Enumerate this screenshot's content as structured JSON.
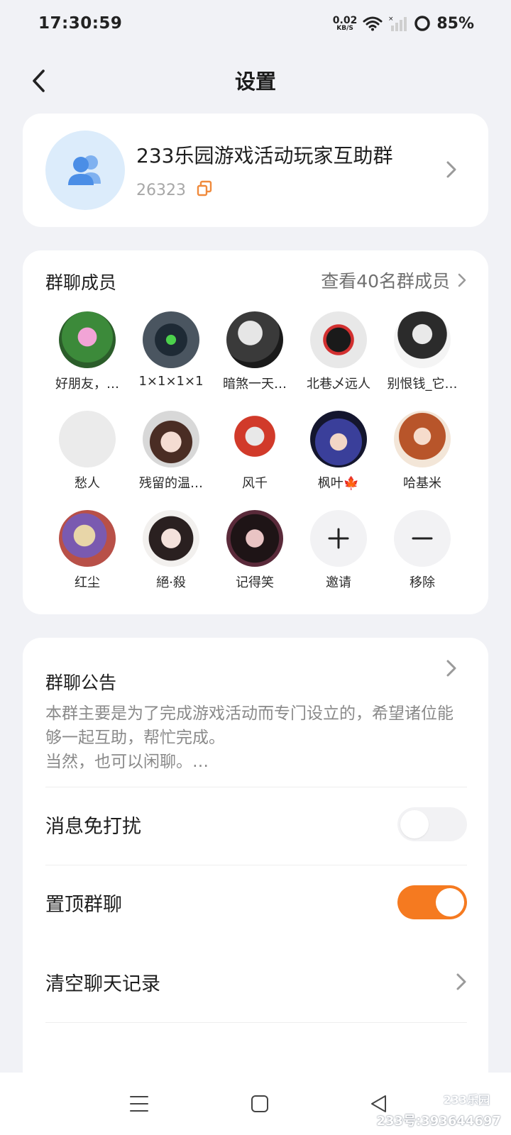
{
  "status_bar": {
    "time": "17:30:59",
    "net_speed_value": "0.02",
    "net_speed_unit": "KB/S",
    "battery": "85%"
  },
  "header": {
    "title": "设置"
  },
  "group": {
    "name": "233乐园游戏活动玩家互助群",
    "id": "26323"
  },
  "members": {
    "title": "群聊成员",
    "view_all": "查看40名群成员",
    "list": [
      {
        "name": "好朋友，…"
      },
      {
        "name": "1×1×1×1"
      },
      {
        "name": "暗煞一天…"
      },
      {
        "name": "北巷乄远人"
      },
      {
        "name": "别恨钱_它…"
      },
      {
        "name": "愁人"
      },
      {
        "name": "残留的温…"
      },
      {
        "name": "风千"
      },
      {
        "name": "枫叶🍁"
      },
      {
        "name": "哈基米"
      },
      {
        "name": "红尘"
      },
      {
        "name": "絕·殺"
      },
      {
        "name": "记得笑"
      }
    ],
    "invite_label": "邀请",
    "remove_label": "移除"
  },
  "settings": {
    "notice_title": "群聊公告",
    "notice_body": "本群主要是为了完成游戏活动而专门设立的，希望诸位能够一起互助，帮忙完成。\n当然，也可以闲聊。…",
    "mute_label": "消息免打扰",
    "mute_on": false,
    "pin_label": "置顶群聊",
    "pin_on": true,
    "clear_label": "清空聊天记录"
  },
  "watermark": {
    "logo": "233乐园",
    "id_text": "233号:393644697"
  },
  "colors": {
    "accent": "#f57a20",
    "page_bg": "#f1f2f6",
    "group_avatar_bg": "#dcecfb",
    "group_avatar_icon": "#4b8ee6",
    "copy_icon": "#f08a3c"
  },
  "icons": {
    "back": "chevron-left-icon",
    "group": "group-people-icon",
    "copy": "copy-icon",
    "chevron": "chevron-right-icon",
    "invite": "plus-icon",
    "remove": "minus-icon",
    "nav_menu": "menu-icon",
    "nav_home": "square-home-icon",
    "nav_back": "triangle-back-icon"
  }
}
